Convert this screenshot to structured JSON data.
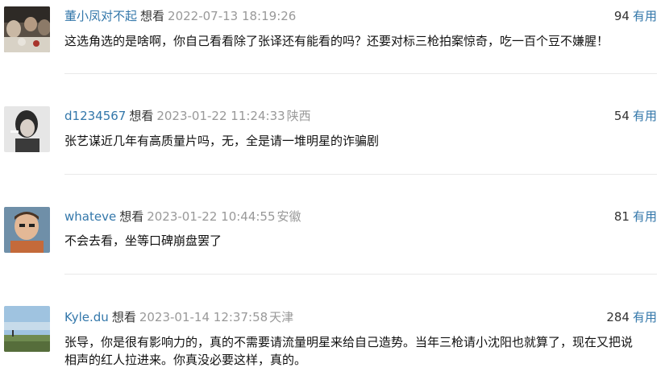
{
  "comments": [
    {
      "user": "董小凤对不起",
      "status": "想看",
      "time": "2022-07-13 18:19:26",
      "location": "",
      "votes": "94",
      "useful_label": "有用",
      "text": "这选角选的是啥啊，你自己看看除了张译还有能看的吗？还要对标三枪拍案惊奇，吃一百个豆不嫌腥！"
    },
    {
      "user": "d1234567",
      "status": "想看",
      "time": "2023-01-22 11:24:33",
      "location": "陕西",
      "votes": "54",
      "useful_label": "有用",
      "text": "张艺谋近几年有高质量片吗，无，全是请一堆明星的诈骗剧"
    },
    {
      "user": "whateve",
      "status": "想看",
      "time": "2023-01-22 10:44:55",
      "location": "安徽",
      "votes": "81",
      "useful_label": "有用",
      "text": "不会去看，坐等口碑崩盘罢了"
    },
    {
      "user": "Kyle.du",
      "status": "想看",
      "time": "2023-01-14 12:37:58",
      "location": "天津",
      "votes": "284",
      "useful_label": "有用",
      "text_line1": "张导，你是很有影响力的，真的不需要请流量明星来给自己造势。当年三枪请小沈阳也就算了，现在又把说",
      "text_line2": "相声的红人拉进来。你真没必要这样，真的。"
    }
  ],
  "colors": {
    "link": "#3377aa",
    "meta": "#999999",
    "text": "#111111"
  }
}
